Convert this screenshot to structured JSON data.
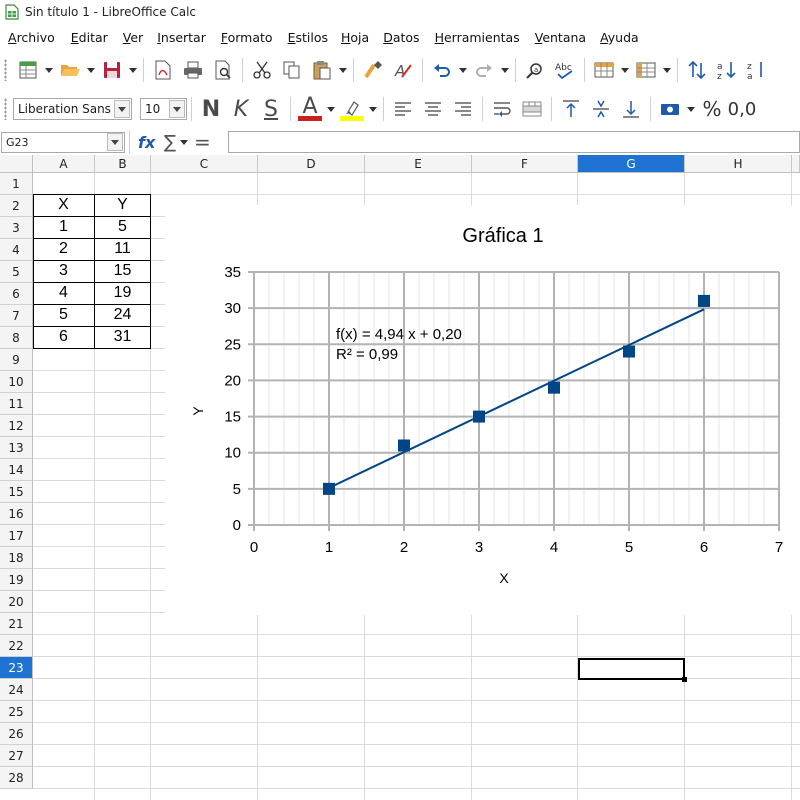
{
  "window": {
    "title": "Sin título 1 - LibreOffice Calc"
  },
  "menu": {
    "items": [
      "Archivo",
      "Editar",
      "Ver",
      "Insertar",
      "Formato",
      "Estilos",
      "Hoja",
      "Datos",
      "Herramientas",
      "Ventana",
      "Ayuda"
    ]
  },
  "toolbar1": {
    "icons": [
      "new-icon",
      "open-icon",
      "save-icon",
      "export-pdf-icon",
      "print-icon",
      "print-preview-icon",
      "cut-icon",
      "copy-icon",
      "paste-icon",
      "clone-formatting-icon",
      "clear-formatting-icon",
      "undo-icon",
      "redo-icon",
      "find-replace-icon",
      "spelling-icon",
      "row-icon",
      "column-icon",
      "sort-icon",
      "sort-ascending-icon",
      "sort-descending-icon"
    ]
  },
  "toolbar2": {
    "font_name": "Liberation Sans",
    "font_size": "10",
    "bold": "N",
    "italic": "K",
    "underline": "S",
    "font_color_letter": "A",
    "font_color": "#c9211e",
    "highlight_color": "#ffff00",
    "percent": "%",
    "number_format": "0,0"
  },
  "formula_bar": {
    "name_box": "G23",
    "fx": "fx",
    "sum": "∑",
    "equals": "=",
    "content": ""
  },
  "grid": {
    "columns": [
      "A",
      "B",
      "C",
      "D",
      "E",
      "F",
      "G",
      "H"
    ],
    "active_column": "G",
    "rows": [
      "1",
      "2",
      "3",
      "4",
      "5",
      "6",
      "7",
      "8",
      "9",
      "10",
      "11",
      "12",
      "13",
      "14",
      "15",
      "16",
      "17",
      "18",
      "19",
      "20",
      "21",
      "22",
      "23",
      "24",
      "25",
      "26",
      "27",
      "28"
    ],
    "active_row": "23",
    "active_cell": "G23"
  },
  "table": {
    "headers": [
      "X",
      "Y"
    ],
    "rows": [
      [
        "1",
        "5"
      ],
      [
        "2",
        "11"
      ],
      [
        "3",
        "15"
      ],
      [
        "4",
        "19"
      ],
      [
        "5",
        "24"
      ],
      [
        "6",
        "31"
      ]
    ]
  },
  "chart_data": {
    "type": "scatter",
    "title": "Gráfica 1",
    "xlabel": "X",
    "ylabel": "Y",
    "xlim": [
      0,
      7
    ],
    "ylim": [
      0,
      35
    ],
    "x_ticks": [
      "0",
      "1",
      "2",
      "3",
      "4",
      "5",
      "6",
      "7"
    ],
    "y_ticks": [
      "0",
      "5",
      "10",
      "15",
      "20",
      "25",
      "30",
      "35"
    ],
    "grid": true,
    "legend": "none",
    "series": [
      {
        "x": [
          1,
          2,
          3,
          4,
          5,
          6
        ],
        "y": [
          5,
          11,
          15,
          19,
          24,
          31
        ],
        "marker": "square",
        "color": "#004586"
      }
    ],
    "trendline": {
      "type": "linear",
      "slope": 4.94,
      "intercept": 0.2,
      "x_range": [
        1,
        6
      ],
      "color": "#004586",
      "equation": "f(x) = 4,94 x + 0,20",
      "r_squared": "R² = 0,99"
    }
  }
}
